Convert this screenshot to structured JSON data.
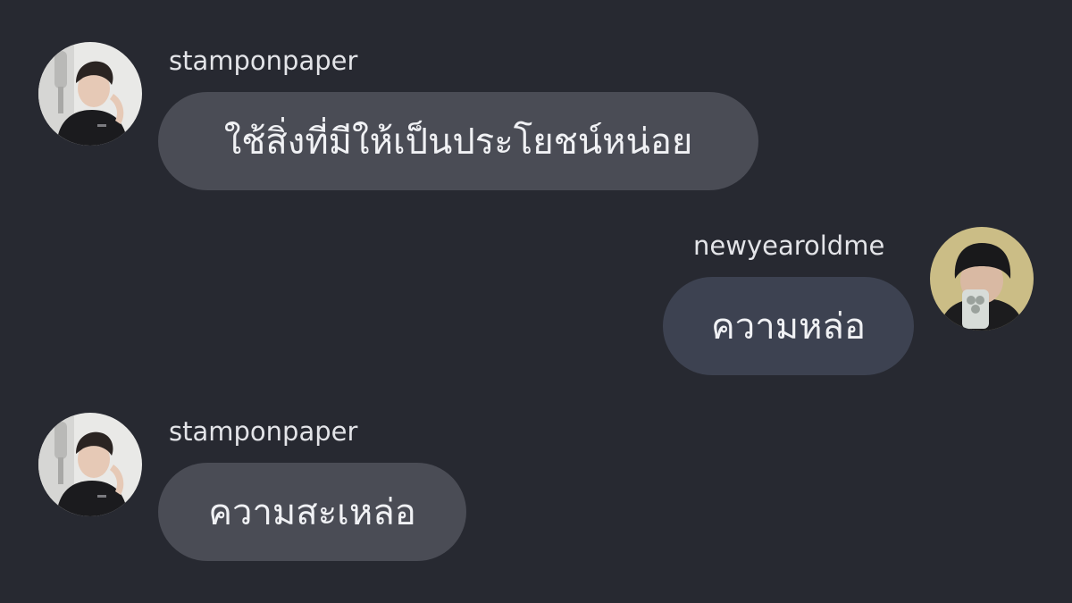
{
  "messages": [
    {
      "sender": "stamponpaper",
      "text": "ใช้สิ่งที่มีให้เป็นประโยชน์หน่อย",
      "direction": "incoming",
      "avatar_icon": "avatar-photo-man-black-tshirt"
    },
    {
      "sender": "newyearoldme",
      "text": "ความหล่อ",
      "direction": "outgoing",
      "avatar_icon": "avatar-photo-man-beanie-phone"
    },
    {
      "sender": "stamponpaper",
      "text": "ความสะเหล่อ",
      "direction": "incoming",
      "avatar_icon": "avatar-photo-man-black-tshirt"
    }
  ],
  "colors": {
    "background": "#272931",
    "incoming_bubble": "#4a4c55",
    "outgoing_bubble": "#3d4251",
    "text": "#f0f1f4"
  }
}
